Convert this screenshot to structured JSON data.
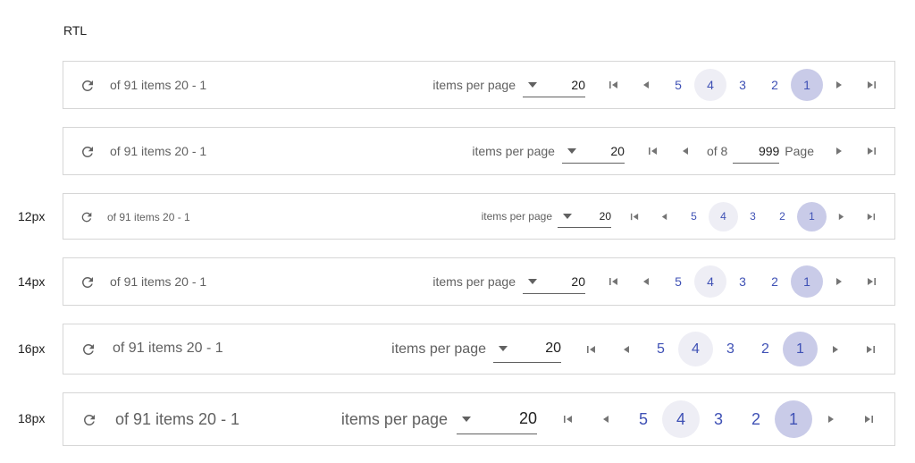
{
  "direction_label": "RTL",
  "size_labels": [
    "12px",
    "14px",
    "16px",
    "18px"
  ],
  "pager": {
    "info": "of 91 items 20 - 1",
    "items_per_page_label": "items per page",
    "page_size_value": "20",
    "pages": [
      "5",
      "4",
      "3",
      "2",
      "1"
    ],
    "selected_page": "1",
    "hovered_page": "4",
    "input_variant": {
      "of_label": "of 8",
      "page_value": "999",
      "page_label": "Page"
    }
  },
  "colors": {
    "accent": "#3f51b5",
    "selected_bg": "#c9cbe8",
    "hover_bg": "#eeeef5",
    "border": "#d6d6d6"
  },
  "icons": {
    "refresh": "refresh-icon",
    "first": "first-page-icon",
    "prev": "previous-page-icon",
    "next": "next-page-icon",
    "last": "last-page-icon"
  }
}
